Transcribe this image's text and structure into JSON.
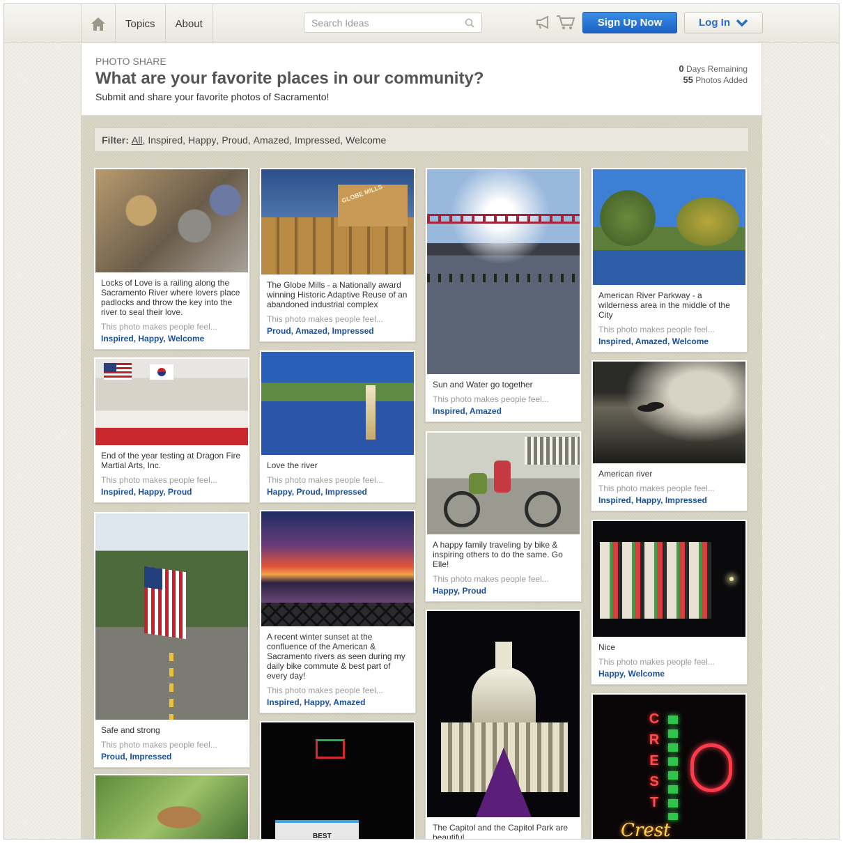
{
  "nav": {
    "topics": "Topics",
    "about": "About",
    "search_placeholder": "Search Ideas",
    "signup": "Sign Up Now",
    "login": "Log In"
  },
  "header": {
    "kicker": "PHOTO SHARE",
    "title": "What are your favorite places in our community?",
    "subtitle": "Submit and share your favorite photos of Sacramento!",
    "days_value": "0",
    "days_label": "Days Remaining",
    "photos_value": "55",
    "photos_label": "Photos Added"
  },
  "filter": {
    "label": "Filter:",
    "options": [
      "All",
      "Inspired",
      "Happy",
      "Proud",
      "Amazed",
      "Impressed",
      "Welcome"
    ]
  },
  "feel_text": "This photo makes people feel...",
  "cards": [
    {
      "caption": "Locks of Love is a railing along the Sacramento River where lovers place padlocks and throw the key into the river to seal their love.",
      "tags": [
        "Inspired",
        "Happy",
        "Welcome"
      ]
    },
    {
      "caption": "End of the year testing at Dragon Fire Martial Arts, Inc.",
      "tags": [
        "Inspired",
        "Happy",
        "Proud"
      ]
    },
    {
      "caption": "Safe and strong",
      "tags": [
        "Proud",
        "Impressed"
      ]
    },
    {
      "caption": "",
      "tags": []
    },
    {
      "caption": "The Globe Mills - a Nationally award winning Historic Adaptive Reuse of an abandoned industrial complex",
      "tags": [
        "Proud",
        "Amazed",
        "Impressed"
      ]
    },
    {
      "caption": "Love the river",
      "tags": [
        "Happy",
        "Proud",
        "Impressed"
      ]
    },
    {
      "caption": "A recent winter sunset at the confluence of the American & Sacramento rivers as seen during my daily bike commute & best part of every day!",
      "tags": [
        "Inspired",
        "Happy",
        "Amazed"
      ]
    },
    {
      "caption": "",
      "tags": []
    },
    {
      "caption": "Sun and Water go together",
      "tags": [
        "Inspired",
        "Amazed"
      ]
    },
    {
      "caption": "A happy family traveling by bike & inspiring others to do the same. Go Elle!",
      "tags": [
        "Happy",
        "Proud"
      ]
    },
    {
      "caption": "The Capitol and the Capitol Park are beautiful",
      "tags": []
    },
    {
      "caption": "American River Parkway - a wilderness area in the middle of the City",
      "tags": [
        "Inspired",
        "Amazed",
        "Welcome"
      ]
    },
    {
      "caption": "American river",
      "tags": [
        "Inspired",
        "Happy",
        "Impressed"
      ]
    },
    {
      "caption": "Nice",
      "tags": [
        "Happy",
        "Welcome"
      ]
    },
    {
      "caption": "",
      "tags": []
    }
  ],
  "image_text": {
    "globe_sign": "GLOBE MILLS",
    "theater_sign": "BEST",
    "crest_sign": "CREST",
    "crest_script": "Crest"
  }
}
